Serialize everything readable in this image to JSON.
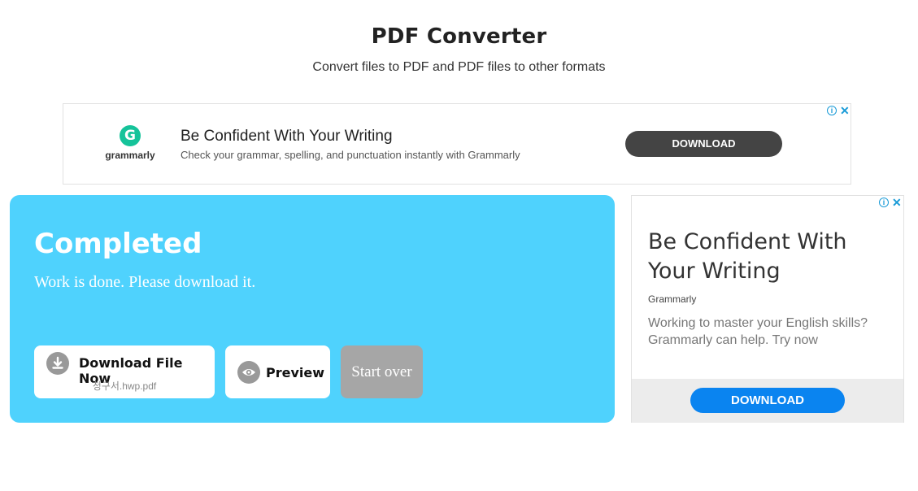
{
  "header": {
    "title": "PDF Converter",
    "subtitle": "Convert files to PDF and PDF files to other formats"
  },
  "ad_top": {
    "brand": "grammarly",
    "logo_letter": "G",
    "headline": "Be Confident With Your Writing",
    "description": "Check your grammar, spelling, and punctuation instantly with Grammarly",
    "button": "DOWNLOAD",
    "info_glyph": "i",
    "close_glyph": "✕"
  },
  "result": {
    "title": "Completed",
    "message": "Work is done. Please download it.",
    "download_label": "Download File Now",
    "file_name": "청구서.hwp.pdf",
    "preview_label": "Preview",
    "start_over_label": "Start over"
  },
  "ad_side": {
    "headline": "Be Confident With Your Writing",
    "advertiser": "Grammarly",
    "body": "Working to master your English skills? Grammarly can help. Try now",
    "button": "DOWNLOAD",
    "info_glyph": "i",
    "close_glyph": "✕"
  },
  "colors": {
    "panel_bg": "#4fd2fd",
    "start_over_bg": "#a6a6a6",
    "ad_top_button": "#444444",
    "ad_side_button": "#0a84f0",
    "grammarly_green": "#15c39a"
  },
  "icons": {
    "download": "download-icon",
    "preview": "eye-icon",
    "ad_info": "info-icon",
    "ad_close": "close-icon",
    "grammarly_logo": "grammarly-logo-icon"
  }
}
